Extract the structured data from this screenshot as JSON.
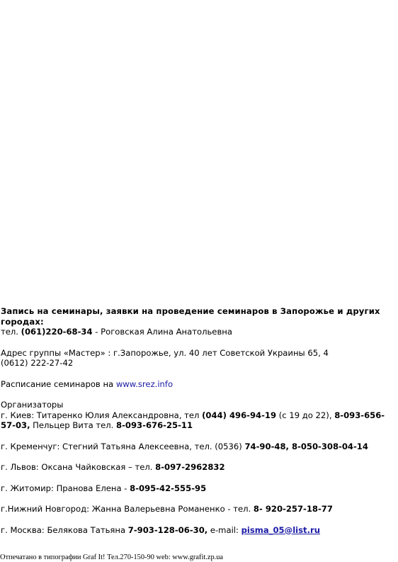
{
  "registration": {
    "heading": "Запись на семинары, заявки на проведение семинаров в Запорожье и других городах:",
    "tel_label": "тел. ",
    "tel_number": "(061)220-68-34",
    "tel_person": " - Роговская Алина Анатольевна"
  },
  "address": {
    "line1": "Адрес группы «Мастер» : г.Запорожье, ул. 40 лет Советской Украины 65, 4",
    "line2": "(0612) 222-27-42"
  },
  "schedule": {
    "label": "Расписание семинаров на ",
    "link": "www.srez.info"
  },
  "organizers": {
    "title": "Организаторы",
    "kiev": {
      "prefix": "г. Киев: Титаренко Юлия Александровна, тел ",
      "phone1": "(044) 496-94-19",
      "hours": " (с 19 до 22), ",
      "phone2": "8-093-656-57-03,",
      "person2": " Пельцер Вита тел. ",
      "phone3": "8-093-676-25-11"
    },
    "kremenchug": {
      "prefix": "г. Кременчуг: Стегний Татьяна Алексеевна, тел. (0536) ",
      "phones": "74-90-48, 8-050-308-04-14"
    },
    "lviv": {
      "prefix": "г. Львов: Оксана Чайковская – тел. ",
      "phone": "8-097-2962832"
    },
    "zhitomir": {
      "prefix": "г. Житомир: Пранова Елена - ",
      "phone": "8-095-42-555-95"
    },
    "novgorod": {
      "prefix": "г.Нижний Новгород:  Жанна Валерьевна Романенко -  тел. ",
      "phone": "8- 920-257-18-77"
    },
    "moscow": {
      "prefix": "г. Москва: Белякова Татьяна ",
      "phone": "7-903-128-06-30,",
      "email_label": " e-mail:   ",
      "email": "pisma_05@list.ru"
    }
  },
  "footer": {
    "text": "Отпечатано в типографии Graf It! Тел.270-150-90 web: www.grafit.zp.ua"
  },
  "colors": {
    "text": "#000000",
    "link": "#1a1aa6",
    "background": "#ffffff"
  }
}
